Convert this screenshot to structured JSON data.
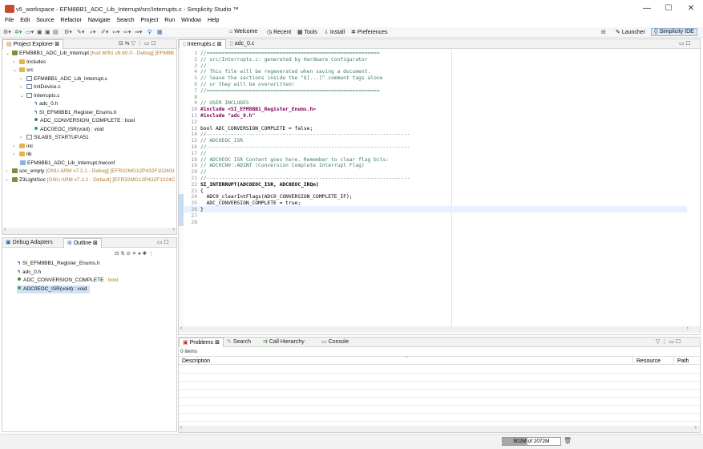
{
  "window": {
    "title": "v5_workspace - EFM8BB1_ADC_Lib_Interrupt/src/Interrupts.c - Simplicity Studio ™",
    "minimize": "—",
    "maximize": "☐",
    "close": "✕"
  },
  "menu": [
    "File",
    "Edit",
    "Source",
    "Refactor",
    "Navigate",
    "Search",
    "Project",
    "Run",
    "Window",
    "Help"
  ],
  "toolbar": {
    "welcome": "Welcome",
    "recent": "Recent",
    "tools": "Tools",
    "install": "Install",
    "preferences": "Preferences",
    "launcher": "Launcher",
    "ide": "Simplicity IDE"
  },
  "project_explorer": {
    "tab": "Project Explorer",
    "items": [
      {
        "label": "EFM8BB1_ADC_Lib_Interrupt",
        "decoration": "[Keil 8051 v9.60.0 - Debug] [EFM8B"
      },
      {
        "label": "Includes"
      },
      {
        "label": "src"
      },
      {
        "label": "EFM8BB1_ADC_Lib_Interrupt.c"
      },
      {
        "label": "InitDevice.c"
      },
      {
        "label": "Interrupts.c"
      },
      {
        "label": "adc_0.h"
      },
      {
        "label": "SI_EFM8BB1_Register_Enums.h"
      },
      {
        "label": "ADC_CONVERSION_COMPLETE : bool"
      },
      {
        "label": "ADC0EOC_ISR(void) : void"
      },
      {
        "label": "SILABS_STARTUP.A51"
      },
      {
        "label": "inc"
      },
      {
        "label": "lib"
      },
      {
        "label": "EFM8BB1_ADC_Lib_Interrupt.hwconf"
      },
      {
        "label": "soc_empty",
        "decoration": "[GNU ARM v7.2.1 - Debug] [EFR32MG12P432F1024GI"
      },
      {
        "label": "Z3LightSoc",
        "decoration": "[GNU ARM v7.2.1 - Default] [EFR32MG12P432F1024C"
      }
    ]
  },
  "bottom_left": {
    "tab_debug": "Debug Adapters",
    "tab_outline": "Outline",
    "outline_items": [
      {
        "label": "SI_EFM8BB1_Register_Enums.h"
      },
      {
        "label": "adc_0.h"
      },
      {
        "label": "ADC_CONVERSION_COMPLETE",
        "decoration": " : bool"
      },
      {
        "label": "ADC0EOC_ISR(void) : void"
      }
    ]
  },
  "editor": {
    "tabs": [
      "Interrupts.c",
      "adc_0.c"
    ],
    "lines": [
      {
        "n": "1",
        "text": "//=========================================================",
        "cls": "cmt"
      },
      {
        "n": "2",
        "text": "// src/Interrupts.c: generated by Hardware Configurator",
        "cls": "cmt"
      },
      {
        "n": "3",
        "text": "//",
        "cls": "cmt"
      },
      {
        "n": "4",
        "text": "// This file will be regenerated when saving a document.",
        "cls": "cmt"
      },
      {
        "n": "5",
        "text": "// leave the sections inside the \"$[...]\" comment tags alone",
        "cls": "cmt"
      },
      {
        "n": "6",
        "text": "// or they will be overwritten!",
        "cls": "cmt"
      },
      {
        "n": "7",
        "text": "//=========================================================",
        "cls": "cmt"
      },
      {
        "n": "8",
        "text": "",
        "cls": ""
      },
      {
        "n": "9",
        "text": "// USER INCLUDES",
        "cls": "cmt"
      },
      {
        "n": "10",
        "text": "#include <SI_EFM8BB1_Register_Enums.h>",
        "cls": "inc"
      },
      {
        "n": "11",
        "text": "#include \"adc_0.h\"",
        "cls": "inc"
      },
      {
        "n": "12",
        "text": "",
        "cls": ""
      },
      {
        "n": "13",
        "text": "bool ADC_CONVERSION_COMPLETE = false;",
        "cls": "decl"
      },
      {
        "n": "14",
        "text": "//-------------------------------------------------------------------",
        "cls": "cmt"
      },
      {
        "n": "15",
        "text": "// ADC0EOC_ISR",
        "cls": "cmt"
      },
      {
        "n": "16",
        "text": "//-------------------------------------------------------------------",
        "cls": "cmt"
      },
      {
        "n": "17",
        "text": "//",
        "cls": "cmt"
      },
      {
        "n": "18",
        "text": "// ADC0EOC ISR Content goes here. Remember to clear flag bits:",
        "cls": "cmt"
      },
      {
        "n": "19",
        "text": "// ADC0CN0::ADINT (Conversion Complete Interrupt Flag)",
        "cls": "cmt"
      },
      {
        "n": "20",
        "text": "//",
        "cls": "cmt"
      },
      {
        "n": "21",
        "text": "//-------------------------------------------------------------------",
        "cls": "cmt"
      },
      {
        "n": "22",
        "text": "SI_INTERRUPT(ADC0EOC_ISR, ADC0EOC_IRQn)",
        "cls": "isr"
      },
      {
        "n": "23",
        "text": "{",
        "cls": ""
      },
      {
        "n": "24",
        "text": "  ADC0_clearIntFlags(ADC0_CONVERSION_COMPLETE_IF);",
        "cls": "call"
      },
      {
        "n": "25",
        "text": "  ADC_CONVERSION_COMPLETE = true;",
        "cls": "assign"
      },
      {
        "n": "26",
        "text": "}",
        "cls": ""
      },
      {
        "n": "27",
        "text": "",
        "cls": ""
      },
      {
        "n": "28",
        "text": "",
        "cls": ""
      }
    ]
  },
  "problems": {
    "tab_problems": "Problems",
    "tab_search": "Search",
    "tab_call_hierarchy": "Call Hierarchy",
    "tab_console": "Console",
    "count": "0 items",
    "col_description": "Description",
    "col_resource": "Resource",
    "col_path": "Path"
  },
  "status": {
    "heap": "902M of 2072M",
    "heap_fraction": 0.435
  }
}
